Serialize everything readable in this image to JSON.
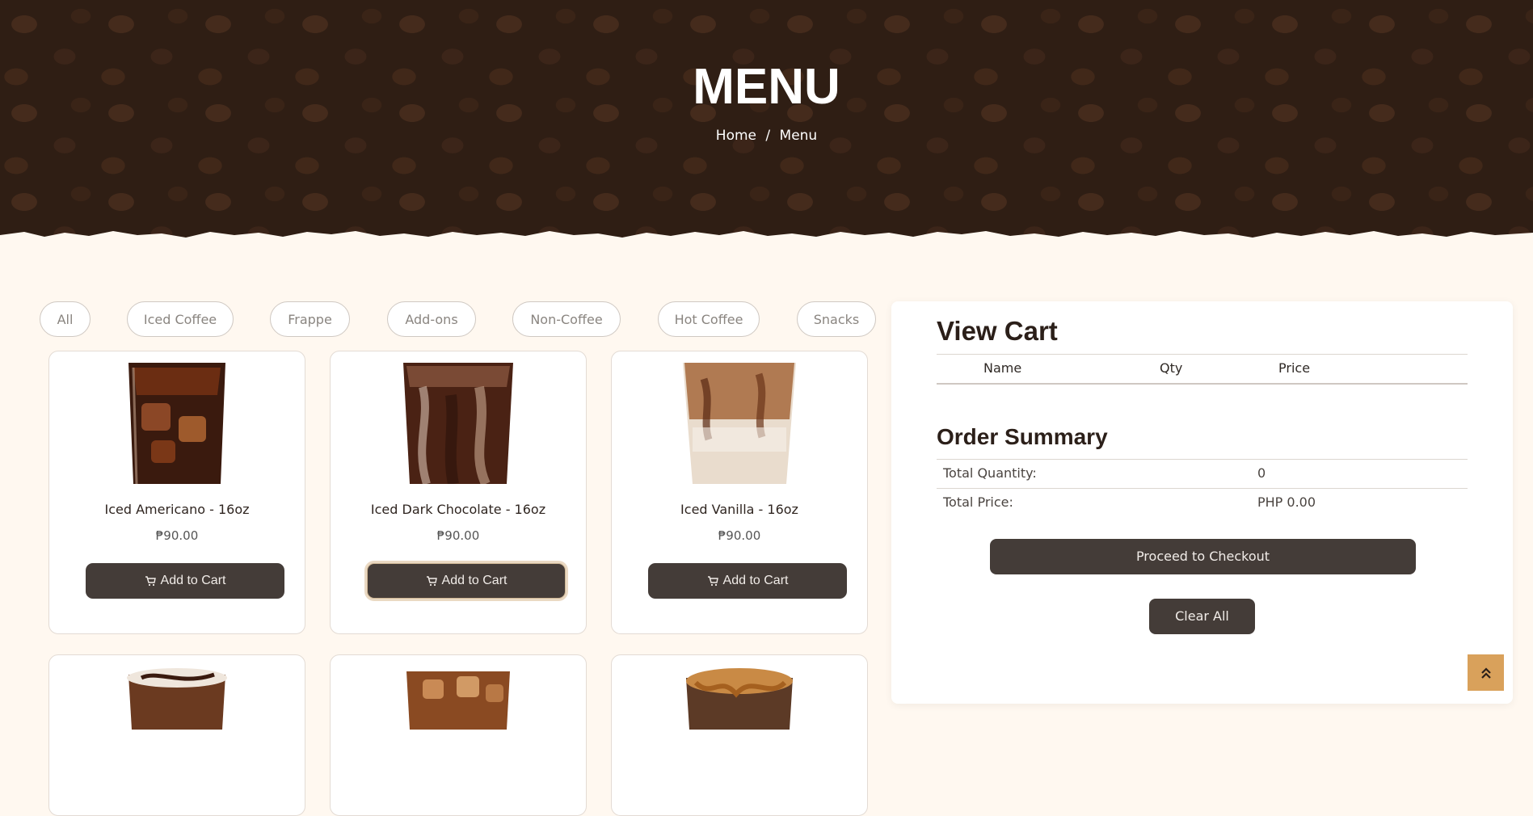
{
  "hero": {
    "title": "MENU",
    "breadcrumb": {
      "home": "Home",
      "separator": "/",
      "current": "Menu"
    }
  },
  "filters": [
    "All",
    "Iced Coffee",
    "Frappe",
    "Add-ons",
    "Non-Coffee",
    "Hot Coffee",
    "Snacks"
  ],
  "products": [
    {
      "name": "Iced Americano - 16oz",
      "price": "₱90.00",
      "button": "Add to Cart"
    },
    {
      "name": "Iced Dark Chocolate - 16oz",
      "price": "₱90.00",
      "button": "Add to Cart"
    },
    {
      "name": "Iced Vanilla - 16oz",
      "price": "₱90.00",
      "button": "Add to Cart"
    }
  ],
  "cart": {
    "title": "View Cart",
    "columns": {
      "name": "Name",
      "qty": "Qty",
      "price": "Price"
    }
  },
  "summary": {
    "title": "Order Summary",
    "total_quantity_label": "Total Quantity:",
    "total_quantity_value": "0",
    "total_price_label": "Total Price:",
    "total_price_value": "PHP 0.00",
    "checkout_label": "Proceed to Checkout",
    "clear_label": "Clear All"
  },
  "colors": {
    "accent": "#d9a15b",
    "button": "#443c38",
    "background": "#fff8f0"
  },
  "icons": [
    "cart-icon",
    "chevrons-up-icon"
  ]
}
